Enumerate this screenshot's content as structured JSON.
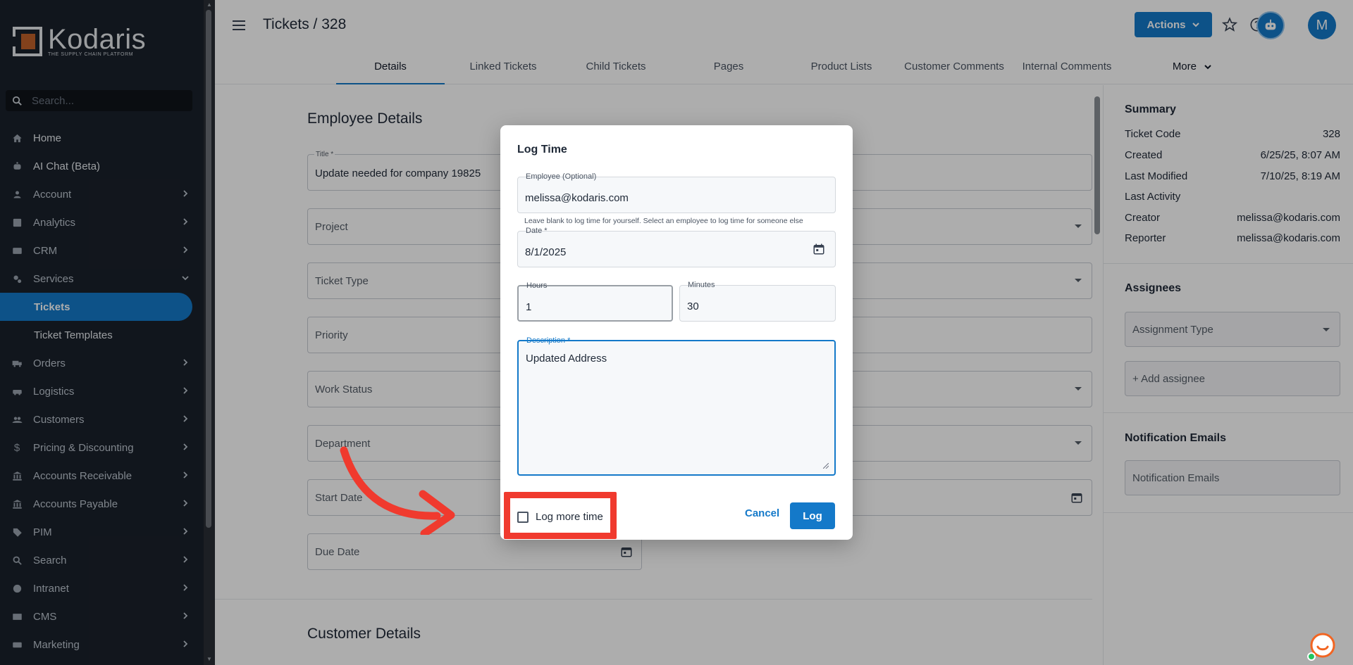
{
  "app": {
    "brand_name": "Kodaris",
    "brand_tagline": "THE SUPPLY CHAIN PLATFORM"
  },
  "sidebar": {
    "search_placeholder": "Search...",
    "items": [
      {
        "label": "Home",
        "icon": "home-icon",
        "has_chevron": false
      },
      {
        "label": "AI Chat (Beta)",
        "icon": "robot-icon",
        "has_chevron": false
      },
      {
        "label": "Account",
        "icon": "person-icon",
        "has_chevron": true
      },
      {
        "label": "Analytics",
        "icon": "analytics-icon",
        "has_chevron": true
      },
      {
        "label": "CRM",
        "icon": "crm-icon",
        "has_chevron": true
      },
      {
        "label": "Services",
        "icon": "services-icon",
        "has_chevron": true,
        "expanded": true
      },
      {
        "label": "Tickets",
        "sub": true,
        "active": true
      },
      {
        "label": "Ticket Templates",
        "sub": true
      },
      {
        "label": "Orders",
        "icon": "truck-icon",
        "has_chevron": true
      },
      {
        "label": "Logistics",
        "icon": "logistics-icon",
        "has_chevron": true
      },
      {
        "label": "Customers",
        "icon": "people-icon",
        "has_chevron": true
      },
      {
        "label": "Pricing & Discounting",
        "icon": "dollar-icon",
        "has_chevron": true
      },
      {
        "label": "Accounts Receivable",
        "icon": "bank-icon",
        "has_chevron": true
      },
      {
        "label": "Accounts Payable",
        "icon": "bank-icon",
        "has_chevron": true
      },
      {
        "label": "PIM",
        "icon": "tag-icon",
        "has_chevron": true
      },
      {
        "label": "Search",
        "icon": "search-icon",
        "has_chevron": true
      },
      {
        "label": "Intranet",
        "icon": "globe-icon",
        "has_chevron": true
      },
      {
        "label": "CMS",
        "icon": "cms-icon",
        "has_chevron": true
      },
      {
        "label": "Marketing",
        "icon": "marketing-icon",
        "has_chevron": true
      }
    ]
  },
  "header": {
    "title": "Tickets / 328",
    "actions_label": "Actions",
    "avatar_initial": "M"
  },
  "tabs": [
    "Details",
    "Linked Tickets",
    "Child Tickets",
    "Pages",
    "Product Lists",
    "Customer Comments",
    "Internal Comments",
    "More"
  ],
  "active_tab": "Details",
  "form": {
    "section_title": "Employee Details",
    "title_label": "Title *",
    "title_value": "Update needed for company 19825",
    "project_label": "Project",
    "ticket_type_label": "Ticket Type",
    "priority_label": "Priority",
    "work_status_label": "Work Status",
    "department_label": "Department",
    "start_date_label": "Start Date",
    "due_date_label": "Due Date",
    "customer_section_title": "Customer Details"
  },
  "summary": {
    "heading": "Summary",
    "rows": [
      {
        "label": "Ticket Code",
        "value": "328"
      },
      {
        "label": "Created",
        "value": "6/25/25, 8:07 AM"
      },
      {
        "label": "Last Modified",
        "value": "7/10/25, 8:19 AM"
      },
      {
        "label": "Last Activity",
        "value": ""
      },
      {
        "label": "Creator",
        "value": "melissa@kodaris.com"
      },
      {
        "label": "Reporter",
        "value": "melissa@kodaris.com"
      }
    ],
    "assignees_heading": "Assignees",
    "assignment_type_label": "Assignment Type",
    "add_assignee_label": "+ Add assignee",
    "notification_heading": "Notification Emails",
    "notification_placeholder": "Notification Emails"
  },
  "dialog": {
    "title": "Log Time",
    "employee_label": "Employee (Optional)",
    "employee_value": "melissa@kodaris.com",
    "employee_helper": "Leave blank to log time for yourself. Select an employee to log time for someone else",
    "date_label": "Date *",
    "date_value": "8/1/2025",
    "hours_label": "Hours",
    "hours_value": "1",
    "minutes_label": "Minutes",
    "minutes_value": "30",
    "description_label": "Description *",
    "description_value": "Updated Address",
    "log_more_label": "Log more time",
    "log_more_checked": false,
    "cancel_label": "Cancel",
    "log_label": "Log"
  },
  "colors": {
    "sidebar_bg": "#1a212b",
    "accent": "#1479c9",
    "highlight": "#f03a2e"
  }
}
